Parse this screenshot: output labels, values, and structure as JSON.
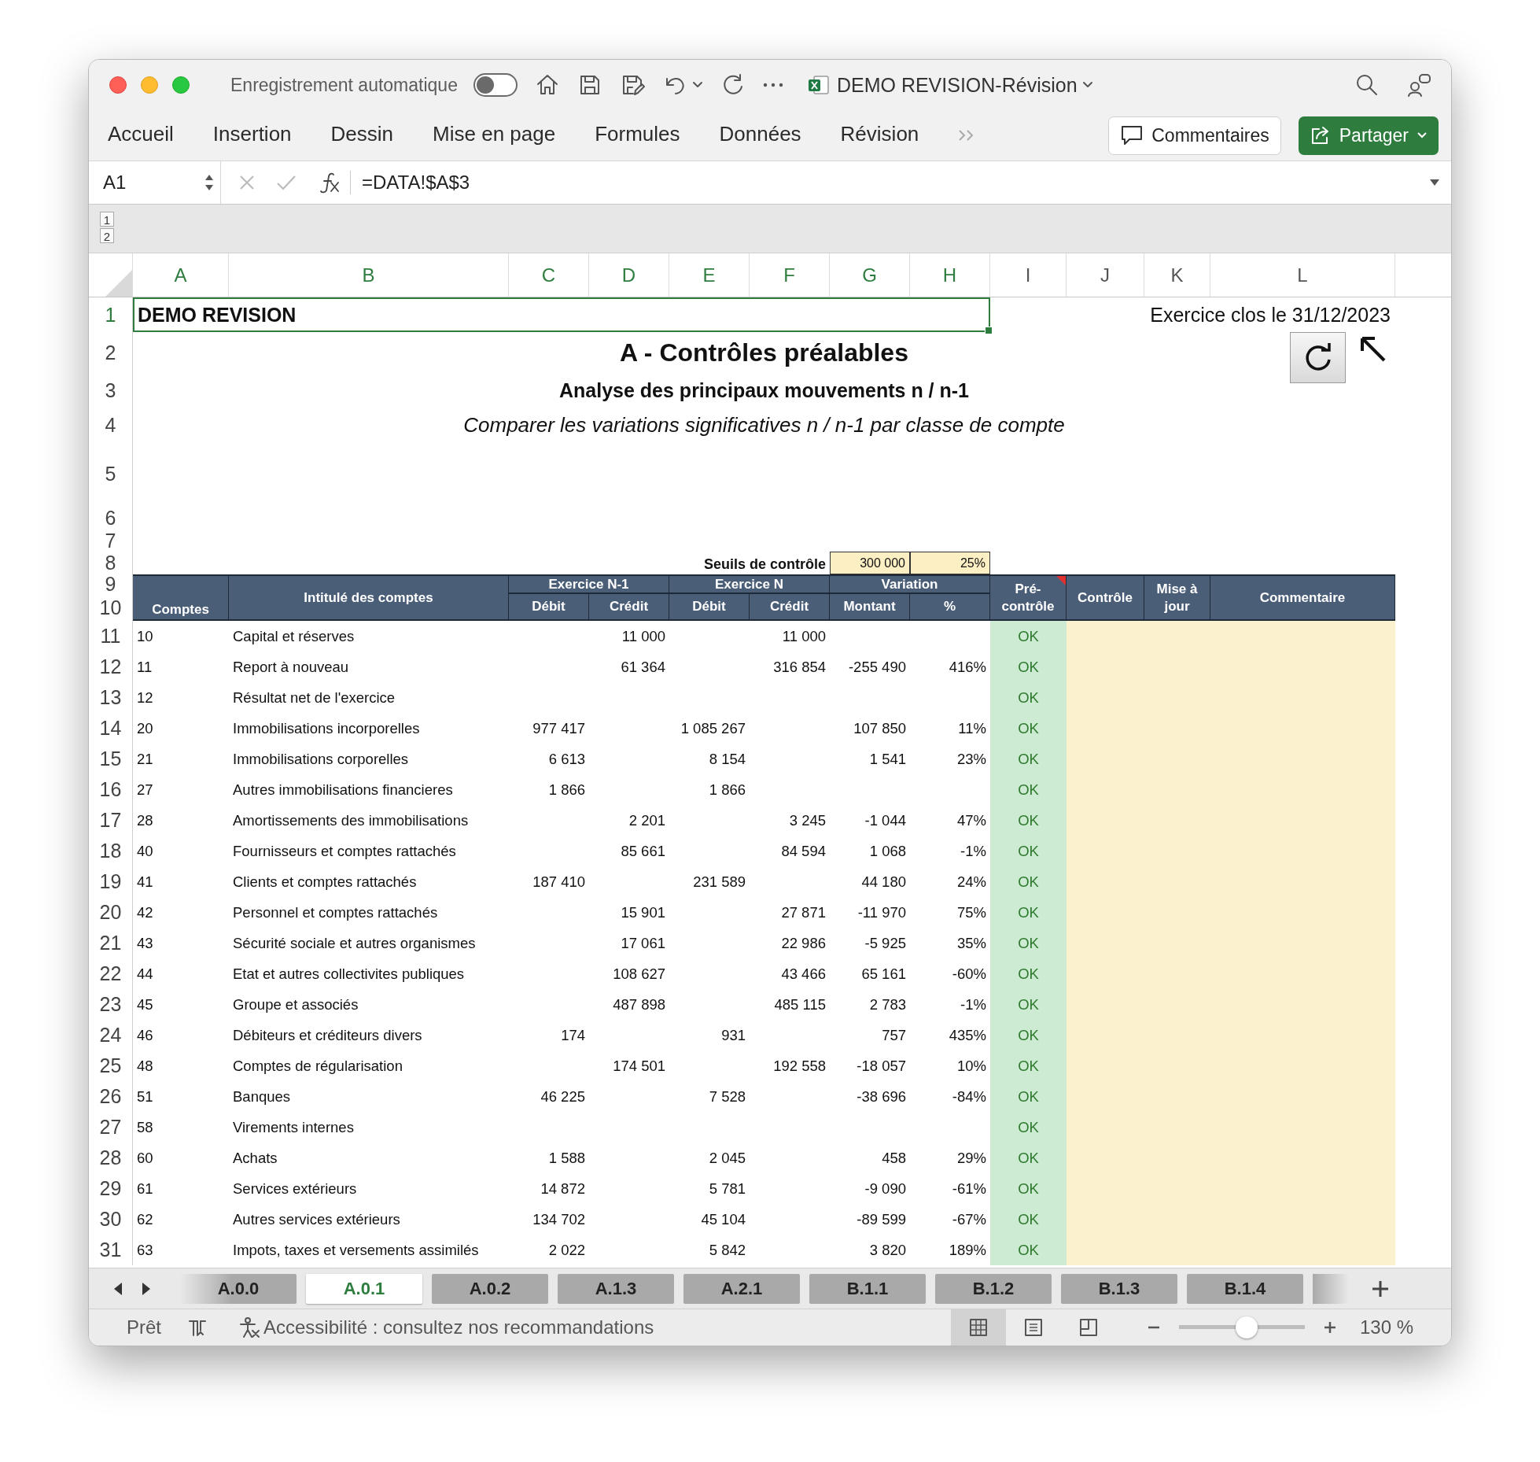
{
  "window": {
    "autosave_label": "Enregistrement automatique",
    "autosave_on": false,
    "title": "DEMO REVISION-Révision"
  },
  "ribbon": {
    "tabs": [
      {
        "label": "Accueil",
        "selected": false
      },
      {
        "label": "Insertion",
        "selected": false
      },
      {
        "label": "Dessin",
        "selected": false
      },
      {
        "label": "Mise en page",
        "selected": false
      },
      {
        "label": "Formules",
        "selected": false
      },
      {
        "label": "Données",
        "selected": false
      },
      {
        "label": "Révision",
        "selected": false
      }
    ],
    "comments_button": "Commentaires",
    "share_button": "Partager"
  },
  "formula_bar": {
    "name_box": "A1",
    "formula": "=DATA!$A$3"
  },
  "outline_levels": [
    "1",
    "2"
  ],
  "columns": [
    {
      "label": "A",
      "selected": true
    },
    {
      "label": "B",
      "selected": true
    },
    {
      "label": "C",
      "selected": true
    },
    {
      "label": "D",
      "selected": true
    },
    {
      "label": "E",
      "selected": true
    },
    {
      "label": "F",
      "selected": true
    },
    {
      "label": "G",
      "selected": true
    },
    {
      "label": "H",
      "selected": true
    },
    {
      "label": "I",
      "selected": false
    },
    {
      "label": "J",
      "selected": false
    },
    {
      "label": "K",
      "selected": false
    },
    {
      "label": "L",
      "selected": false
    }
  ],
  "row_headers": [
    {
      "label": "1",
      "selected": true
    },
    {
      "label": "2",
      "selected": false
    },
    {
      "label": "3",
      "selected": false
    },
    {
      "label": "4",
      "selected": false
    },
    {
      "label": "5",
      "selected": false
    },
    {
      "label": "6",
      "selected": false
    },
    {
      "label": "7",
      "selected": false
    },
    {
      "label": "8",
      "selected": false
    },
    {
      "label": "9",
      "selected": false
    },
    {
      "label": "10",
      "selected": false
    },
    {
      "label": "11",
      "selected": false
    },
    {
      "label": "12",
      "selected": false
    },
    {
      "label": "13",
      "selected": false
    },
    {
      "label": "14",
      "selected": false
    },
    {
      "label": "15",
      "selected": false
    },
    {
      "label": "16",
      "selected": false
    },
    {
      "label": "17",
      "selected": false
    },
    {
      "label": "18",
      "selected": false
    },
    {
      "label": "19",
      "selected": false
    },
    {
      "label": "20",
      "selected": false
    },
    {
      "label": "21",
      "selected": false
    },
    {
      "label": "22",
      "selected": false
    },
    {
      "label": "23",
      "selected": false
    },
    {
      "label": "24",
      "selected": false
    },
    {
      "label": "25",
      "selected": false
    },
    {
      "label": "26",
      "selected": false
    },
    {
      "label": "27",
      "selected": false
    },
    {
      "label": "28",
      "selected": false
    },
    {
      "label": "29",
      "selected": false
    },
    {
      "label": "30",
      "selected": false
    },
    {
      "label": "31",
      "selected": false
    }
  ],
  "sheet": {
    "a1": "DEMO REVISION",
    "period": "Exercice clos le 31/12/2023",
    "title": "A - Contrôles préalables",
    "subtitle": "Analyse des principaux mouvements n / n-1",
    "instruction": "Comparer les variations significatives n / n-1 par classe de compte",
    "thresholds_label": "Seuils de contrôle",
    "threshold_amount": "300 000",
    "threshold_pct": "25%"
  },
  "table": {
    "headers": {
      "account": "Comptes",
      "label": "Intitulé des comptes",
      "prev_year": "Exercice N-1",
      "year": "Exercice N",
      "variation": "Variation",
      "debit_prev": "Débit",
      "credit_prev": "Crédit",
      "debit": "Débit",
      "credit": "Crédit",
      "change": "Montant",
      "change_pct": "%",
      "precheck": "Pré-contrôle",
      "control": "Contrôle",
      "update": "Mise à jour",
      "comment": "Commentaire"
    },
    "rows": [
      {
        "account": "10",
        "label": "Capital et réserves",
        "credit_prev": "11 000",
        "credit": "11 000",
        "precheck": "OK"
      },
      {
        "account": "11",
        "label": "Report à nouveau",
        "credit_prev": "61 364",
        "credit": "316 854",
        "change": "-255 490",
        "change_pct": "416%",
        "precheck": "OK"
      },
      {
        "account": "12",
        "label": "Résultat net de l'exercice",
        "precheck": "OK"
      },
      {
        "account": "20",
        "label": "Immobilisations incorporelles",
        "debit_prev": "977 417",
        "debit": "1 085 267",
        "change": "107 850",
        "change_pct": "11%",
        "precheck": "OK"
      },
      {
        "account": "21",
        "label": "Immobilisations corporelles",
        "debit_prev": "6 613",
        "debit": "8 154",
        "change": "1 541",
        "change_pct": "23%",
        "precheck": "OK"
      },
      {
        "account": "27",
        "label": "Autres immobilisations financieres",
        "debit_prev": "1 866",
        "debit": "1 866",
        "precheck": "OK"
      },
      {
        "account": "28",
        "label": "Amortissements des immobilisations",
        "credit_prev": "2 201",
        "credit": "3 245",
        "change": "-1 044",
        "change_pct": "47%",
        "precheck": "OK"
      },
      {
        "account": "40",
        "label": "Fournisseurs et comptes rattachés",
        "credit_prev": "85 661",
        "credit": "84 594",
        "change": "1 068",
        "change_pct": "-1%",
        "precheck": "OK"
      },
      {
        "account": "41",
        "label": "Clients et comptes rattachés",
        "debit_prev": "187 410",
        "debit": "231 589",
        "change": "44 180",
        "change_pct": "24%",
        "precheck": "OK"
      },
      {
        "account": "42",
        "label": "Personnel et comptes rattachés",
        "credit_prev": "15 901",
        "credit": "27 871",
        "change": "-11 970",
        "change_pct": "75%",
        "precheck": "OK"
      },
      {
        "account": "43",
        "label": "Sécurité sociale et autres organismes",
        "credit_prev": "17 061",
        "credit": "22 986",
        "change": "-5 925",
        "change_pct": "35%",
        "precheck": "OK"
      },
      {
        "account": "44",
        "label": "Etat et autres collectivites publiques",
        "credit_prev": "108 627",
        "credit": "43 466",
        "change": "65 161",
        "change_pct": "-60%",
        "precheck": "OK"
      },
      {
        "account": "45",
        "label": "Groupe et associés",
        "credit_prev": "487 898",
        "credit": "485 115",
        "change": "2 783",
        "change_pct": "-1%",
        "precheck": "OK"
      },
      {
        "account": "46",
        "label": "Débiteurs et créditeurs divers",
        "debit_prev": "174",
        "debit": "931",
        "change": "757",
        "change_pct": "435%",
        "precheck": "OK"
      },
      {
        "account": "48",
        "label": "Comptes de régularisation",
        "credit_prev": "174 501",
        "credit": "192 558",
        "change": "-18 057",
        "change_pct": "10%",
        "precheck": "OK"
      },
      {
        "account": "51",
        "label": "Banques",
        "debit_prev": "46 225",
        "debit": "7 528",
        "change": "-38 696",
        "change_pct": "-84%",
        "precheck": "OK"
      },
      {
        "account": "58",
        "label": "Virements internes",
        "precheck": "OK"
      },
      {
        "account": "60",
        "label": "Achats",
        "debit_prev": "1 588",
        "debit": "2 045",
        "change": "458",
        "change_pct": "29%",
        "precheck": "OK"
      },
      {
        "account": "61",
        "label": "Services extérieurs",
        "debit_prev": "14 872",
        "debit": "5 781",
        "change": "-9 090",
        "change_pct": "-61%",
        "precheck": "OK"
      },
      {
        "account": "62",
        "label": "Autres services extérieurs",
        "debit_prev": "134 702",
        "debit": "45 104",
        "change": "-89 599",
        "change_pct": "-67%",
        "precheck": "OK"
      },
      {
        "account": "63",
        "label": "Impots, taxes et versements assimilés",
        "debit_prev": "2 022",
        "debit": "5 842",
        "change": "3 820",
        "change_pct": "189%",
        "precheck": "OK"
      }
    ]
  },
  "sheet_tabs": [
    {
      "label": "A.0.0",
      "selected": false
    },
    {
      "label": "A.0.1",
      "selected": true
    },
    {
      "label": "A.0.2",
      "selected": false
    },
    {
      "label": "A.1.3",
      "selected": false
    },
    {
      "label": "A.2.1",
      "selected": false
    },
    {
      "label": "B.1.1",
      "selected": false
    },
    {
      "label": "B.1.2",
      "selected": false
    },
    {
      "label": "B.1.3",
      "selected": false
    },
    {
      "label": "B.1.4",
      "selected": false
    }
  ],
  "status_bar": {
    "ready": "Prêt",
    "accessibility": "Accessibilité : consultez nos recommandations",
    "views": [
      {
        "kind": "normal",
        "selected": true
      },
      {
        "kind": "page_layout",
        "selected": false
      },
      {
        "kind": "page_break",
        "selected": false
      }
    ],
    "zoom": {
      "level": 0.54,
      "reading": "130 %"
    }
  }
}
